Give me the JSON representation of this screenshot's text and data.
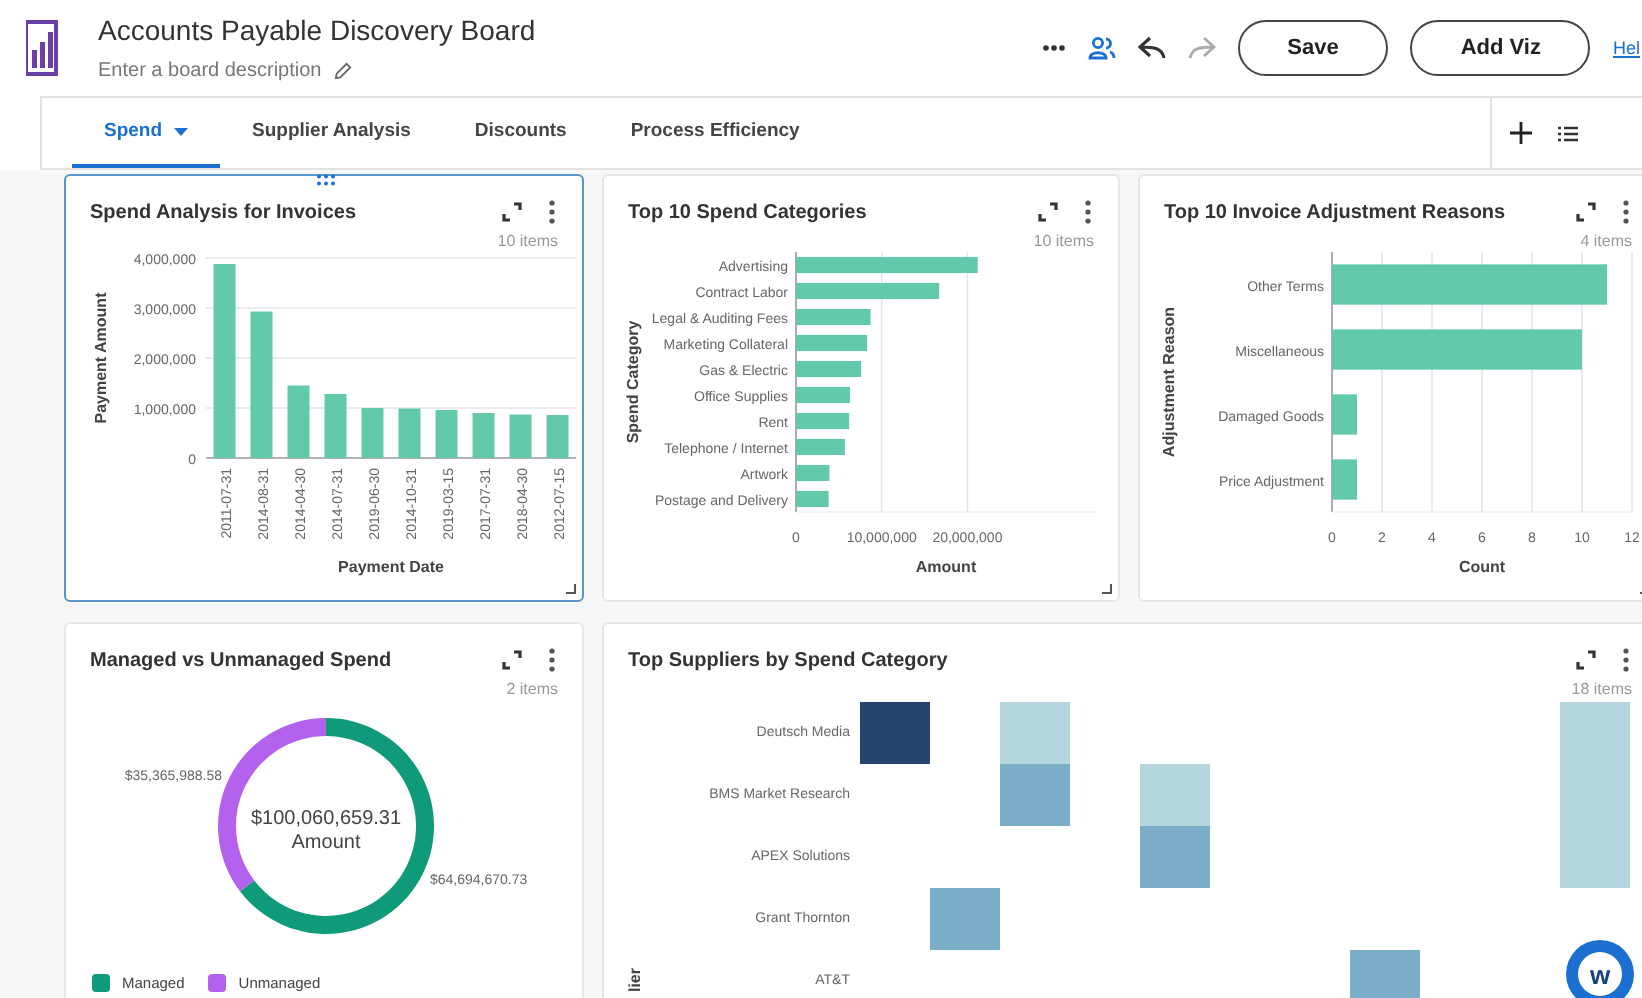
{
  "header": {
    "title": "Accounts Payable Discovery Board",
    "description_placeholder": "Enter a board description",
    "buttons": [
      "Save",
      "Add Viz"
    ],
    "help_link": "Hel"
  },
  "tabs": [
    {
      "label": "Spend",
      "selected": true,
      "has_menu": true
    },
    {
      "label": "Supplier Analysis",
      "selected": false,
      "has_menu": false
    },
    {
      "label": "Discounts",
      "selected": false,
      "has_menu": false
    },
    {
      "label": "Process Efficiency",
      "selected": false,
      "has_menu": false
    }
  ],
  "cards": [
    {
      "kind": "chart",
      "title": "Spend Analysis for Invoices",
      "items": "10 items",
      "selected": true,
      "chart_data": {
        "type": "bar",
        "orientation": "vertical",
        "grid": true,
        "xlabel": "Payment Date",
        "ylabel": "Payment Amount",
        "categories": [
          "2011-07-31",
          "2014-08-31",
          "2014-04-30",
          "2014-07-31",
          "2019-06-30",
          "2014-10-31",
          "2019-03-15",
          "2017-07-31",
          "2018-04-30",
          "2012-07-15"
        ],
        "series": [
          {
            "color": "#63c9ab",
            "values": [
              3880000,
              2930000,
              1450000,
              1280000,
              1000000,
              990000,
              960000,
              900000,
              870000,
              860000
            ]
          }
        ],
        "ylim": [
          0,
          4000000
        ],
        "yticks": [
          {
            "value": 0,
            "label": "0"
          },
          {
            "value": 1000000,
            "label": "1,000,000"
          },
          {
            "value": 2000000,
            "label": "2,000,000"
          },
          {
            "value": 3000000,
            "label": "3,000,000"
          },
          {
            "value": 4000000,
            "label": "4,000,000"
          }
        ]
      }
    },
    {
      "kind": "chart",
      "title": "Top 10 Spend Categories",
      "items": "10 items",
      "selected": false,
      "chart_data": {
        "type": "bar",
        "orientation": "horizontal",
        "grid": true,
        "xlabel": "Amount",
        "ylabel": "Spend Category",
        "categories": [
          "Advertising",
          "Contract Labor",
          "Legal & Auditing Fees",
          "Marketing Collateral",
          "Gas & Electric",
          "Office Supplies",
          "Rent",
          "Telephone / Internet",
          "Artwork",
          "Postage and Delivery"
        ],
        "series": [
          {
            "color": "#63c9ab",
            "values": [
              21200000,
              16700000,
              8700000,
              8300000,
              7600000,
              6300000,
              6200000,
              5700000,
              3900000,
              3800000
            ]
          }
        ],
        "xlim": [
          0,
          35000000
        ],
        "xticks": [
          {
            "value": 0,
            "label": "0"
          },
          {
            "value": 10000000,
            "label": "10,000,000"
          },
          {
            "value": 20000000,
            "label": "20,000,000"
          }
        ]
      }
    },
    {
      "kind": "chart",
      "title": "Top 10 Invoice Adjustment Reasons",
      "items": "4 items",
      "selected": false,
      "chart_data": {
        "type": "bar",
        "orientation": "horizontal",
        "grid": true,
        "xlabel": "Count",
        "ylabel": "Adjustment Reason",
        "categories": [
          "Other Terms",
          "Miscellaneous",
          "Damaged Goods",
          "Price Adjustment"
        ],
        "series": [
          {
            "color": "#63c9ab",
            "values": [
              11,
              10,
              1,
              1
            ]
          }
        ],
        "xlim": [
          0,
          12
        ],
        "xticks": [
          0,
          2,
          4,
          6,
          8,
          10,
          12
        ]
      }
    },
    {
      "kind": "chart",
      "title": "Managed vs Unmanaged Spend",
      "items": "2 items",
      "selected": false,
      "chart_data": {
        "type": "donut",
        "categories": [
          "Managed",
          "Unmanaged"
        ],
        "series": [
          {
            "values": [
              64.66,
              35.34
            ]
          }
        ],
        "value_labels": [
          "$64,694,670.73",
          "$35,365,988.58"
        ]
      },
      "total": "$100,060,659.31",
      "total_label": "Amount",
      "legend": [
        {
          "color": "#0f9b79"
        },
        {
          "color": "#b462ee"
        }
      ]
    },
    {
      "kind": "heatmap",
      "title": "Top Suppliers by Spend Category",
      "items": "18 items",
      "selected": false,
      "y_axis_title": "lier",
      "rows": [
        {
          "label": "Deutsch Media",
          "cells": [
            {
              "color": "#26456e"
            },
            null,
            {
              "color": "#b4d5dc"
            },
            null,
            null,
            null,
            null,
            null,
            null,
            null,
            {
              "color": "#b4d5dc"
            }
          ]
        },
        {
          "label": "BMS Market Research",
          "cells": [
            null,
            null,
            {
              "color": "#7aaec8"
            },
            null,
            {
              "color": "#b4d5dc"
            },
            null,
            null,
            null,
            null,
            null,
            {
              "color": "#b4d5dc"
            }
          ]
        },
        {
          "label": "APEX Solutions",
          "cells": [
            null,
            null,
            null,
            null,
            {
              "color": "#7aaec8"
            },
            null,
            null,
            null,
            null,
            null,
            {
              "color": "#b4d5dc"
            }
          ]
        },
        {
          "label": "Grant Thornton",
          "cells": [
            null,
            {
              "color": "#7aaec8"
            },
            null,
            null,
            null,
            null,
            null,
            null,
            null,
            null,
            null
          ]
        },
        {
          "label": "AT&T",
          "cells": [
            null,
            null,
            null,
            null,
            null,
            null,
            null,
            {
              "color": "#7aaec8"
            },
            null,
            null,
            null
          ]
        }
      ]
    }
  ],
  "help_badge": "w"
}
